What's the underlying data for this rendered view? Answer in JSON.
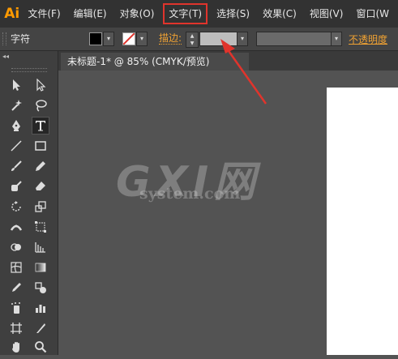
{
  "app": {
    "logo": "Ai"
  },
  "menu": [
    {
      "label": "文件(F)"
    },
    {
      "label": "编辑(E)"
    },
    {
      "label": "对象(O)"
    },
    {
      "label": "文字(T)",
      "highlighted": true
    },
    {
      "label": "选择(S)"
    },
    {
      "label": "效果(C)"
    },
    {
      "label": "视图(V)"
    },
    {
      "label": "窗口(W"
    }
  ],
  "control_bar": {
    "tool_name": "字符",
    "fill_color": "#000000",
    "stroke_swatch": "none",
    "stroke_label": "描边:",
    "opacity_label": "不透明度"
  },
  "document": {
    "tab_title": "未标题-1* @ 85% (CMYK/预览)"
  },
  "toolbox": {
    "collapse_glyph": "◂◂",
    "tools": [
      "selection-tool-icon",
      "direct-selection-tool-icon",
      "magic-wand-tool-icon",
      "lasso-tool-icon",
      "pen-tool-icon",
      "type-tool-icon",
      "line-tool-icon",
      "rectangle-tool-icon",
      "paintbrush-tool-icon",
      "pencil-tool-icon",
      "blob-brush-tool-icon",
      "eraser-tool-icon",
      "rotate-tool-icon",
      "scale-tool-icon",
      "width-tool-icon",
      "free-transform-tool-icon",
      "shape-builder-tool-icon",
      "perspective-grid-tool-icon",
      "mesh-tool-icon",
      "gradient-tool-icon",
      "eyedropper-tool-icon",
      "blend-tool-icon",
      "symbol-sprayer-tool-icon",
      "column-graph-tool-icon",
      "artboard-tool-icon",
      "slice-tool-icon",
      "hand-tool-icon",
      "zoom-tool-icon"
    ],
    "active_tool": "type-tool-icon"
  },
  "watermark": {
    "main": "GXI网",
    "sub": "system.com"
  },
  "colors": {
    "menubar": "#323232",
    "highlight_box": "#e0342c",
    "accent_orange": "#f0a233",
    "canvas": "#535353",
    "artboard": "#ffffff"
  }
}
